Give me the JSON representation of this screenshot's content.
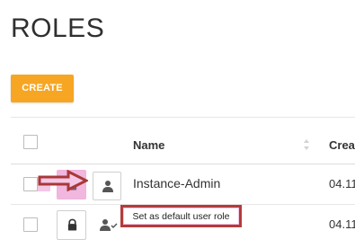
{
  "page": {
    "title": "ROLES"
  },
  "toolbar": {
    "create_label": "CREATE"
  },
  "table": {
    "columns": [
      {
        "label": "Name"
      },
      {
        "label": "Crea"
      }
    ],
    "rows": [
      {
        "name": "Instance-Admin",
        "created": "04.11"
      },
      {
        "name": "",
        "created": "04.11"
      }
    ]
  },
  "tooltip": {
    "text": "Set as default user role"
  },
  "icons": [
    "checkbox-icon",
    "sort-icon",
    "lock-icon",
    "person-icon",
    "person-check-icon",
    "arrow-right-icon"
  ],
  "colors": {
    "create_button": "#f6a623",
    "annotation_red": "#b43b3b",
    "annotation_pink": "#f4c7e6"
  }
}
